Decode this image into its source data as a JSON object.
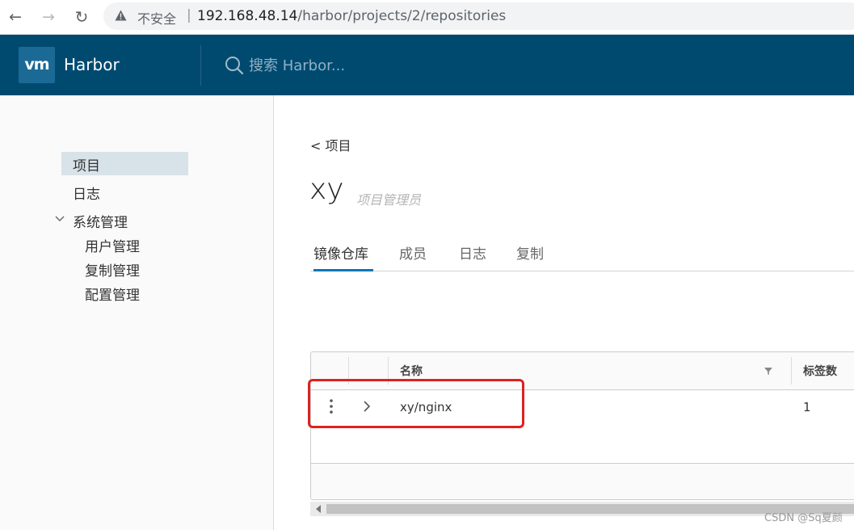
{
  "browser": {
    "security_label": "不安全",
    "separator": "|",
    "url_host": "192.168.48.14",
    "url_path": "/harbor/projects/2/repositories"
  },
  "header": {
    "logo_text": "vm",
    "brand": "Harbor",
    "search_placeholder": "搜索 Harbor..."
  },
  "sidebar": {
    "items": [
      {
        "label": "项目"
      },
      {
        "label": "日志"
      },
      {
        "label": "系统管理"
      },
      {
        "label": "用户管理"
      },
      {
        "label": "复制管理"
      },
      {
        "label": "配置管理"
      }
    ]
  },
  "main": {
    "back_link": "< 项目",
    "project_name": "xy",
    "project_role": "项目管理员",
    "tabs": [
      {
        "label": "镜像仓库"
      },
      {
        "label": "成员"
      },
      {
        "label": "日志"
      },
      {
        "label": "复制"
      }
    ],
    "grid": {
      "columns": [
        "名称",
        "标签数"
      ],
      "rows": [
        {
          "name": "xy/nginx",
          "tags": "1"
        }
      ]
    }
  },
  "watermark": "CSDN @Sq夏颜",
  "colors": {
    "header_bg": "#004a70",
    "active_tab": "#0079b8",
    "highlight": "#e02020"
  }
}
